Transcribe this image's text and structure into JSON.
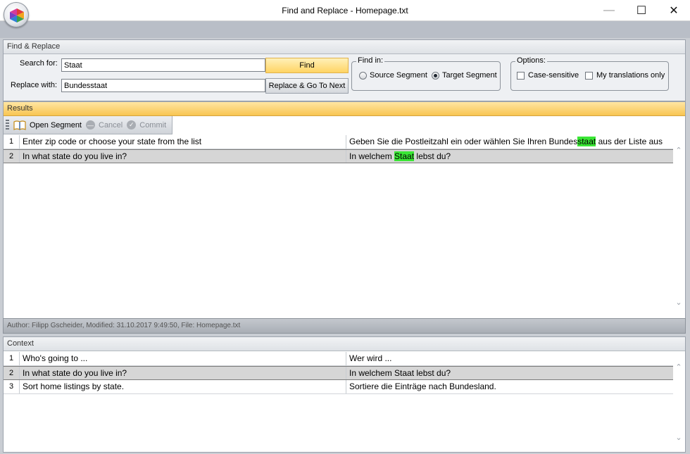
{
  "window": {
    "title": "Find and Replace - Homepage.txt",
    "minimize_glyph": "—",
    "maximize_glyph": "☐",
    "close_glyph": "✕"
  },
  "find_replace": {
    "header": "Find & Replace",
    "search_label": "Search for:",
    "search_value": "Staat",
    "replace_label": "Replace with:",
    "replace_value": "Bundesstaat",
    "find_button": "Find",
    "replace_button": "Replace & Go To Next",
    "find_in": {
      "title": "Find in:",
      "source": "Source Segment",
      "target": "Target Segment",
      "selected": "target"
    },
    "options": {
      "title": "Options:",
      "case_sensitive": "Case-sensitive",
      "case_sensitive_checked": false,
      "my_translations_only": "My translations only",
      "my_translations_only_checked": false
    }
  },
  "results": {
    "header": "Results",
    "toolbar": {
      "open_segment": "Open Segment",
      "cancel": "Cancel",
      "commit": "Commit"
    },
    "rows": [
      {
        "num": "1",
        "source": "Enter zip code or choose your state from the list",
        "target_before": "Geben Sie die Postleitzahl ein oder wählen Sie Ihren Bundes",
        "target_match": "staat",
        "target_after": " aus der Liste aus",
        "selected": false
      },
      {
        "num": "2",
        "source": "In what state do you live in?",
        "target_before": "In welchem ",
        "target_match": "Staat",
        "target_after": " lebst du?",
        "selected": true
      }
    ],
    "highlight_color": "#3ae635"
  },
  "status": {
    "text": "Author: Filipp Gscheider, Modified: 31.10.2017 9:49:50, File: Homepage.txt"
  },
  "context": {
    "header": "Context",
    "rows": [
      {
        "num": "1",
        "source": "Who's going to ...",
        "target": "Wer wird ..."
      },
      {
        "num": "2",
        "source": "In what state do you live in?",
        "target": "In welchem Staat lebst du?"
      },
      {
        "num": "3",
        "source": "Sort home listings by state.",
        "target": "Sortiere die Einträge nach Bundesland."
      }
    ]
  },
  "icons": {
    "logo": "app-logo-icon",
    "open_segment": "open-book-icon",
    "cancel": "cancel-circle-icon",
    "commit": "check-circle-icon"
  }
}
